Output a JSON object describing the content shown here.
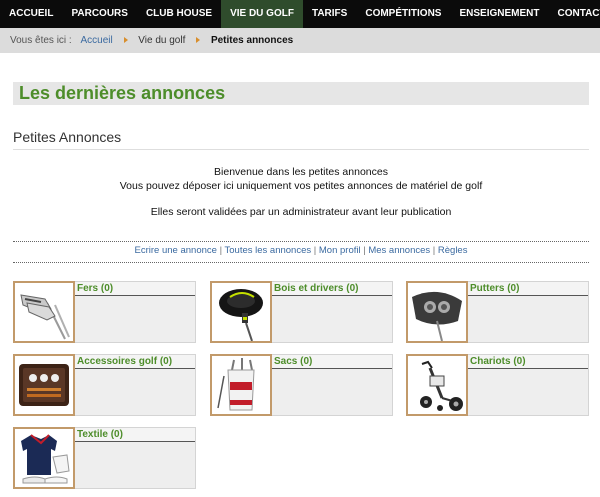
{
  "nav": {
    "items": [
      "ACCUEIL",
      "PARCOURS",
      "CLUB HOUSE",
      "VIE DU GOLF",
      "TARIFS",
      "COMPÉTITIONS",
      "ENSEIGNEMENT",
      "CONTACT"
    ],
    "active_index": 3
  },
  "breadcrumb": {
    "prefix": "Vous êtes ici :",
    "home": "Accueil",
    "section": "Vie du golf",
    "current": "Petites annonces"
  },
  "page": {
    "title": "Les dernières annonces",
    "subtitle": "Petites Annonces"
  },
  "welcome": {
    "line1": "Bienvenue dans les petites annonces",
    "line2": "Vous pouvez déposer ici uniquement vos petites annonces de matériel de golf",
    "line3": "Elles seront validées par un administrateur avant leur publication"
  },
  "links": {
    "write": "Ecrire une annonce",
    "all": "Toutes les annonces",
    "profile": "Mon profil",
    "mine": "Mes annonces",
    "rules": "Règles",
    "separator": "|"
  },
  "categories": [
    {
      "label": "Fers (0)",
      "icon": "irons-icon"
    },
    {
      "label": "Bois et drivers (0)",
      "icon": "driver-icon"
    },
    {
      "label": "Putters (0)",
      "icon": "putter-icon"
    },
    {
      "label": "Accessoires golf (0)",
      "icon": "accessories-icon"
    },
    {
      "label": "Sacs (0)",
      "icon": "golf-bag-icon"
    },
    {
      "label": "Chariots (0)",
      "icon": "trolley-icon"
    },
    {
      "label": "Textile (0)",
      "icon": "textile-icon"
    }
  ],
  "colors": {
    "nav_bg": "#0b0b0b",
    "nav_active": "#2f4c2c",
    "title_green": "#4d8d2a",
    "link_blue": "#3b6aa0",
    "thumb_border": "#c29a6a"
  }
}
